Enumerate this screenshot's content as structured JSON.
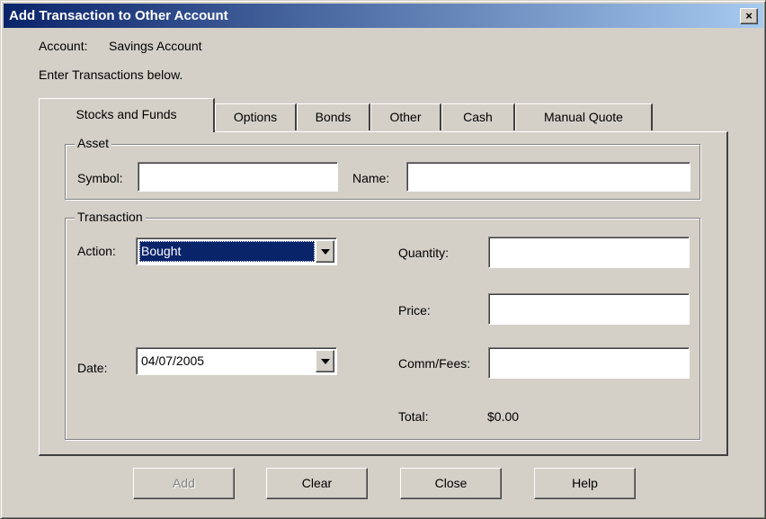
{
  "window": {
    "title": "Add Transaction to Other Account",
    "close_label": "×"
  },
  "header": {
    "account_label": "Account:",
    "account_value": "Savings Account",
    "instructions": "Enter Transactions below."
  },
  "tabs": [
    {
      "label": "Stocks and Funds",
      "active": true
    },
    {
      "label": "Options"
    },
    {
      "label": "Bonds"
    },
    {
      "label": "Other"
    },
    {
      "label": "Cash"
    },
    {
      "label": "Manual Quote"
    }
  ],
  "asset": {
    "group_label": "Asset",
    "symbol_label": "Symbol:",
    "symbol_value": "",
    "name_label": "Name:",
    "name_value": ""
  },
  "transaction": {
    "group_label": "Transaction",
    "action_label": "Action:",
    "action_value": "Bought",
    "date_label": "Date:",
    "date_value": "04/07/2005",
    "quantity_label": "Quantity:",
    "quantity_value": "",
    "price_label": "Price:",
    "price_value": "",
    "comm_label": "Comm/Fees:",
    "comm_value": "",
    "total_label": "Total:",
    "total_value": "$0.00"
  },
  "buttons": {
    "add": "Add",
    "clear": "Clear",
    "close": "Close",
    "help": "Help"
  },
  "colors": {
    "face": "#d4d0c8",
    "title_start": "#0a246a",
    "title_end": "#a6caf0",
    "selection": "#0a246a"
  }
}
